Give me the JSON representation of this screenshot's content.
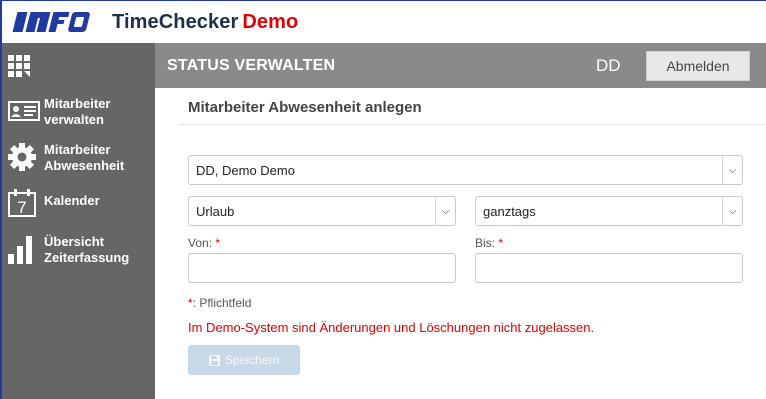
{
  "app": {
    "logo_text": "INFO",
    "title": "TimeChecker",
    "title_suffix": "Demo",
    "colors": {
      "accent_red": "#e00000",
      "sidebar": "#666666",
      "header_bar": "#8a8a8a",
      "logo_blue": "#1f3aa0"
    }
  },
  "sidebar": {
    "grid_icon": "apps-grid-icon",
    "items": [
      {
        "label": "Mitarbeiter verwalten",
        "icon": "id-card-icon"
      },
      {
        "label": "Mitarbeiter Abwesenheit",
        "icon": "gear-icon"
      },
      {
        "label": "Kalender",
        "icon": "calendar-icon",
        "calendar_day": "7"
      },
      {
        "label": "Übersicht Zeiterfassung",
        "icon": "bar-chart-icon"
      }
    ]
  },
  "header": {
    "title": "STATUS VERWALTEN",
    "user": "DD",
    "logout_label": "Abmelden"
  },
  "form": {
    "section_title": "Mitarbeiter Abwesenheit anlegen",
    "employee_select": "DD, Demo Demo",
    "type_select": "Urlaub",
    "duration_select": "ganztags",
    "from_label": "Von:",
    "to_label": "Bis:",
    "required_marker": "*",
    "from_value": "",
    "to_value": "",
    "required_hint": ": Pflichtfeld",
    "demo_warning": "Im Demo-System sind Änderungen und Löschungen nicht zugelassen.",
    "save_label": "Speichern"
  }
}
